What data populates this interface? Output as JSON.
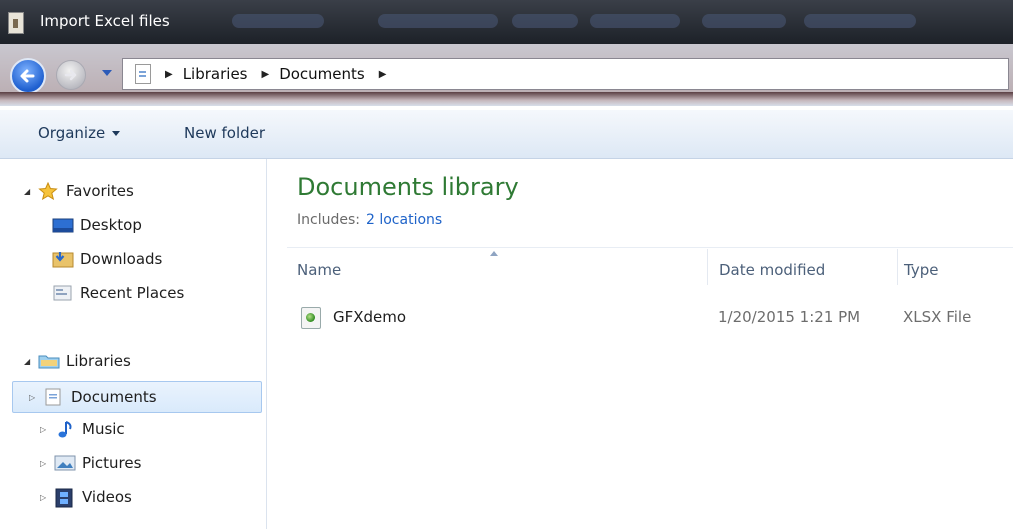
{
  "window": {
    "title": "Import Excel files"
  },
  "address": {
    "crumbs": [
      "Libraries",
      "Documents"
    ]
  },
  "toolbar": {
    "organize_label": "Organize",
    "new_folder_label": "New folder"
  },
  "nav": {
    "favorites": {
      "label": "Favorites",
      "items": [
        {
          "label": "Desktop",
          "icon": "desktop-icon"
        },
        {
          "label": "Downloads",
          "icon": "downloads-folder-icon"
        },
        {
          "label": "Recent Places",
          "icon": "recent-places-icon"
        }
      ]
    },
    "libraries": {
      "label": "Libraries",
      "items": [
        {
          "label": "Documents",
          "icon": "documents-icon",
          "selected": true
        },
        {
          "label": "Music",
          "icon": "music-icon"
        },
        {
          "label": "Pictures",
          "icon": "pictures-icon"
        },
        {
          "label": "Videos",
          "icon": "videos-icon"
        }
      ]
    }
  },
  "content": {
    "library_title": "Documents library",
    "includes_label": "Includes:",
    "includes_link": "2 locations",
    "columns": {
      "name": "Name",
      "date": "Date modified",
      "type": "Type"
    },
    "files": [
      {
        "name": "GFXdemo",
        "date": "1/20/2015 1:21 PM",
        "type": "XLSX File",
        "icon": "excel-file-icon"
      }
    ]
  },
  "colors": {
    "library_title": "#2f7a34",
    "link": "#1e63c9",
    "selection_border": "#a7c8ef"
  }
}
